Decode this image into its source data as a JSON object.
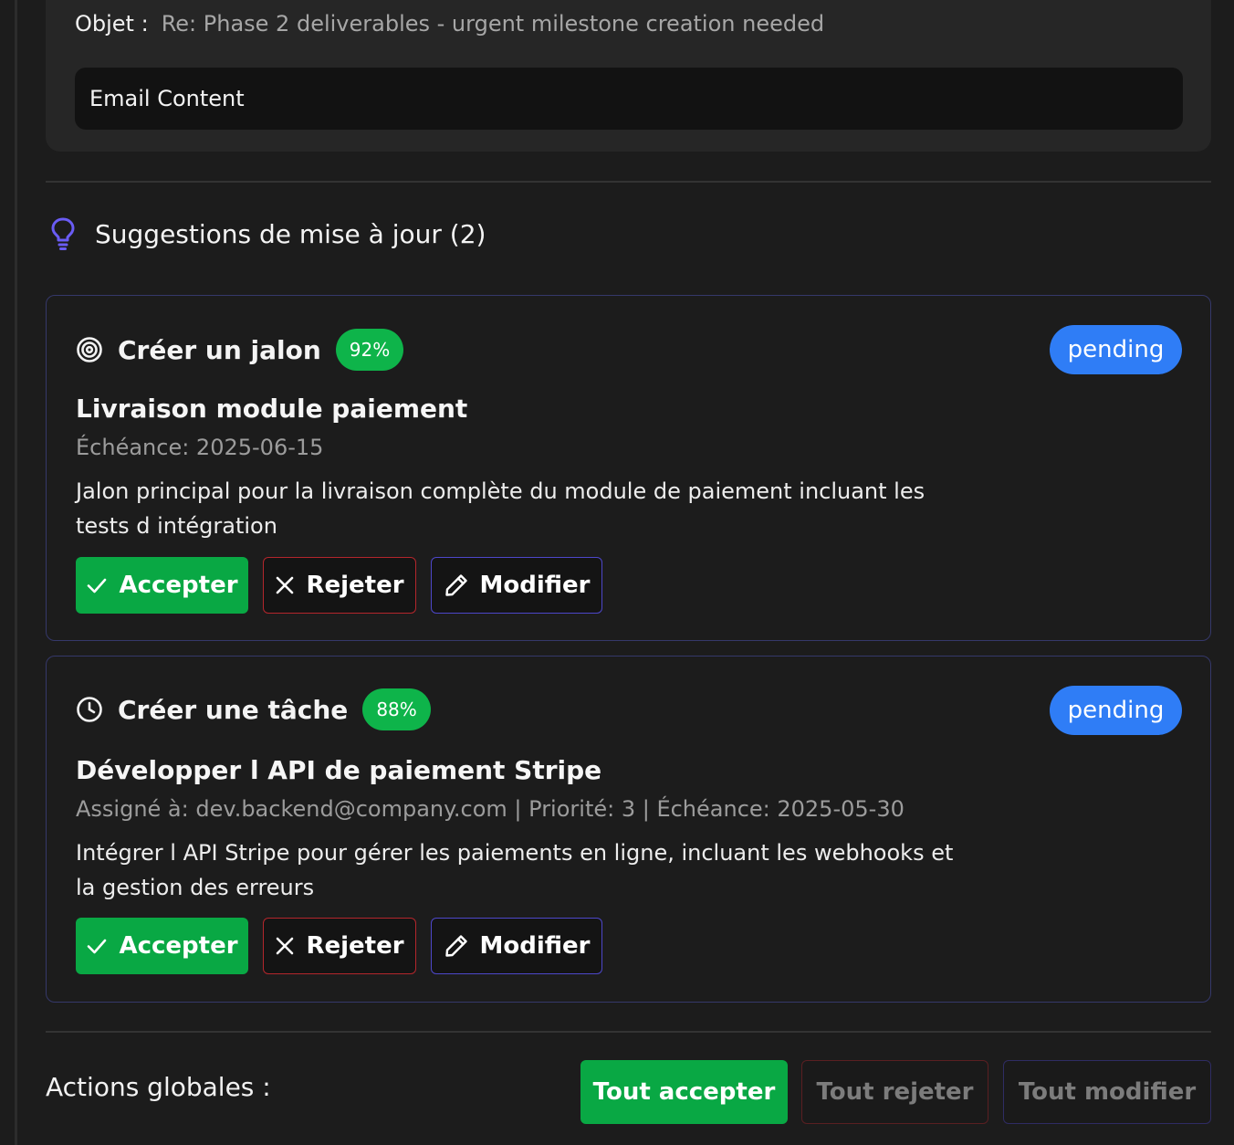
{
  "email": {
    "subject_label": "Objet :",
    "subject_value": "Re: Phase 2 deliverables - urgent milestone creation needed",
    "content_label": "Email Content"
  },
  "suggestions": {
    "title": "Suggestions de mise à jour (2)",
    "icon": "lightbulb-icon",
    "items": [
      {
        "type_label": "Créer un jalon",
        "type_icon": "target-icon",
        "confidence": "92%",
        "status": "pending",
        "title": "Livraison module paiement",
        "meta": "Échéance: 2025-06-15",
        "description": "Jalon principal pour la livraison complète du module de paiement incluant les tests d intégration",
        "accept_label": "Accepter",
        "reject_label": "Rejeter",
        "modify_label": "Modifier"
      },
      {
        "type_label": "Créer une tâche",
        "type_icon": "clock-icon",
        "confidence": "88%",
        "status": "pending",
        "title": "Développer l API de paiement Stripe",
        "meta": "Assigné à: dev.backend@company.com | Priorité: 3 | Échéance: 2025-05-30",
        "description": "Intégrer l API Stripe pour gérer les paiements en ligne, incluant les webhooks et la gestion des erreurs",
        "accept_label": "Accepter",
        "reject_label": "Rejeter",
        "modify_label": "Modifier"
      }
    ]
  },
  "global_actions": {
    "label": "Actions globales :",
    "accept_all": "Tout accepter",
    "reject_all": "Tout rejeter",
    "modify_all": "Tout modifier"
  },
  "colors": {
    "accent_purple": "#6a5cf5",
    "accept_green": "#09a844",
    "confidence_green": "#0eb44a",
    "pending_blue": "#2f7df6",
    "reject_red": "#b3262c",
    "modify_indigo": "#4d47c9"
  }
}
